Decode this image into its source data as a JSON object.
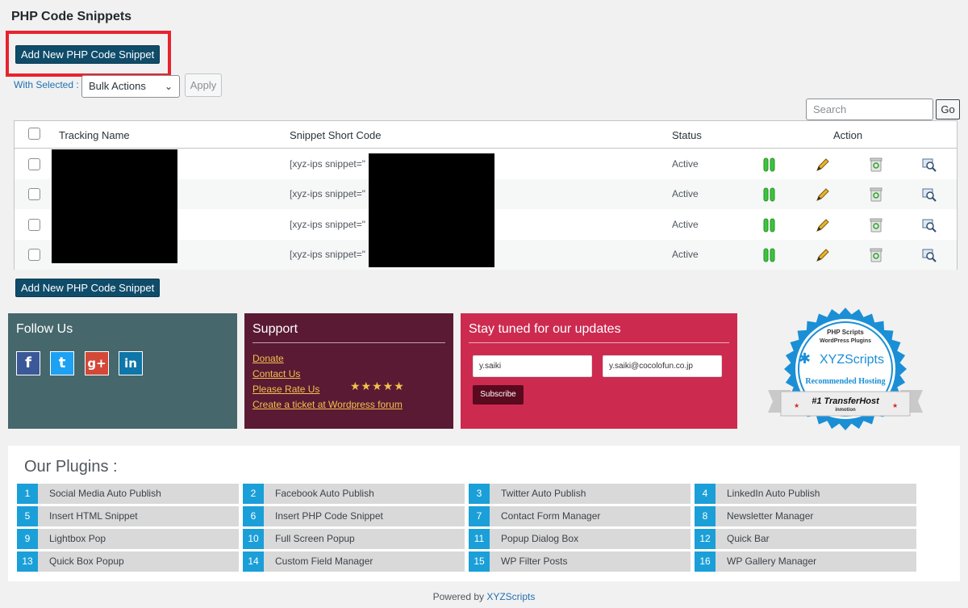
{
  "page": {
    "title": "PHP Code Snippets"
  },
  "toolbar": {
    "add_button_label": "Add New PHP Code Snippet",
    "with_selected_label": "With Selected :",
    "bulk_select_value": "Bulk Actions",
    "apply_label": "Apply",
    "search_placeholder": "Search",
    "go_label": "Go"
  },
  "table": {
    "headers": {
      "name": "Tracking Name",
      "shortcode": "Snippet Short Code",
      "status": "Status",
      "action": "Action"
    },
    "rows": [
      {
        "shortcode_prefix": "[xyz-ips snippet=\"",
        "status": "Active"
      },
      {
        "shortcode_prefix": "[xyz-ips snippet=\"",
        "status": "Active"
      },
      {
        "shortcode_prefix": "[xyz-ips snippet=\"",
        "status": "Active"
      },
      {
        "shortcode_prefix": "[xyz-ips snippet=\"",
        "status": "Active"
      }
    ],
    "action_icons": [
      "pause-icon",
      "edit-pencil-icon",
      "trash-icon",
      "preview-icon"
    ]
  },
  "bottom_button_label": "Add New PHP Code Snippet",
  "follow": {
    "title": "Follow Us",
    "networks": [
      {
        "name": "facebook-icon",
        "glyph": "f",
        "color": "#3b5998"
      },
      {
        "name": "twitter-icon",
        "glyph": "t",
        "color": "#1da1f2"
      },
      {
        "name": "google-plus-icon",
        "glyph": "g+",
        "color": "#d34836"
      },
      {
        "name": "linkedin-icon",
        "glyph": "in",
        "color": "#0e76a8"
      }
    ]
  },
  "support": {
    "title": "Support",
    "links": [
      "Donate",
      "Contact Us",
      "Please Rate Us",
      "Create a ticket at Wordpress forum"
    ],
    "stars": "★★★★★"
  },
  "updates": {
    "title": "Stay tuned for our updates",
    "name_value": "y.saiki",
    "email_value": "y.saiki@cocolofun.co.jp",
    "subscribe_label": "Subscribe"
  },
  "badge": {
    "line1": "PHP Scripts",
    "line2": "WordPress Plugins",
    "brand": "XYZScripts",
    "recommended": "Recommended Hosting",
    "ribbon": "#1 TransferHost",
    "ribbon_sub": "inmotion"
  },
  "plugins": {
    "title": "Our Plugins :",
    "items": [
      {
        "num": "1",
        "label": "Social Media Auto Publish"
      },
      {
        "num": "2",
        "label": "Facebook Auto Publish"
      },
      {
        "num": "3",
        "label": "Twitter Auto Publish"
      },
      {
        "num": "4",
        "label": "LinkedIn Auto Publish"
      },
      {
        "num": "5",
        "label": "Insert HTML Snippet"
      },
      {
        "num": "6",
        "label": "Insert PHP Code Snippet"
      },
      {
        "num": "7",
        "label": "Contact Form Manager"
      },
      {
        "num": "8",
        "label": "Newsletter Manager"
      },
      {
        "num": "9",
        "label": "Lightbox Pop"
      },
      {
        "num": "10",
        "label": "Full Screen Popup"
      },
      {
        "num": "11",
        "label": "Popup Dialog Box"
      },
      {
        "num": "12",
        "label": "Quick Bar"
      },
      {
        "num": "13",
        "label": "Quick Box Popup"
      },
      {
        "num": "14",
        "label": "Custom Field Manager"
      },
      {
        "num": "15",
        "label": "WP Filter Posts"
      },
      {
        "num": "16",
        "label": "WP Gallery Manager"
      }
    ]
  },
  "footer": {
    "prefix": "Powered by",
    "link": "XYZScripts"
  },
  "colors": {
    "primary_button": "#0f4c6a",
    "highlight": "#e8232f",
    "follow_panel": "#46676c",
    "support_panel": "#5a1a33",
    "updates_panel": "#cd2a50",
    "plugin_number": "#1b9fd8"
  }
}
